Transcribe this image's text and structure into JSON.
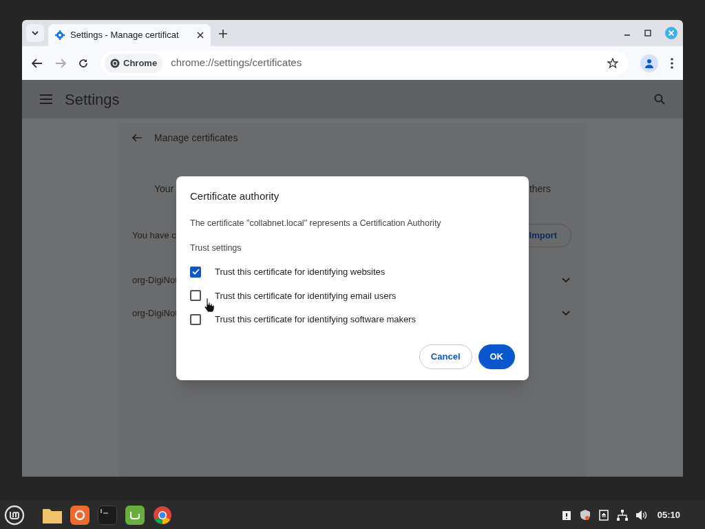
{
  "browser": {
    "tab": {
      "title": "Settings - Manage certificat",
      "selected": true
    },
    "omnibox": {
      "chip": "Chrome",
      "url": "chrome://settings/certificates"
    }
  },
  "settings": {
    "title": "Settings",
    "page_title": "Manage certificates",
    "intro_left": "Your",
    "intro_right": "thers",
    "info": "You have c",
    "import_button": "Import",
    "rows": [
      {
        "label": "org-DigiNot"
      },
      {
        "label": "org-DigiNot"
      }
    ]
  },
  "dialog": {
    "title": "Certificate authority",
    "message": "The certificate \"collabnet.local\" represents a Certification Authority",
    "section": "Trust settings",
    "options": [
      {
        "label": "Trust this certificate for identifying websites",
        "checked": true
      },
      {
        "label": "Trust this certificate for identifying email users",
        "checked": false
      },
      {
        "label": "Trust this certificate for identifying software makers",
        "checked": false
      }
    ],
    "buttons": [
      {
        "label": "Cancel",
        "kind": "secondary"
      },
      {
        "label": "OK",
        "kind": "primary"
      }
    ]
  },
  "taskbar": {
    "clock": "05:10"
  }
}
